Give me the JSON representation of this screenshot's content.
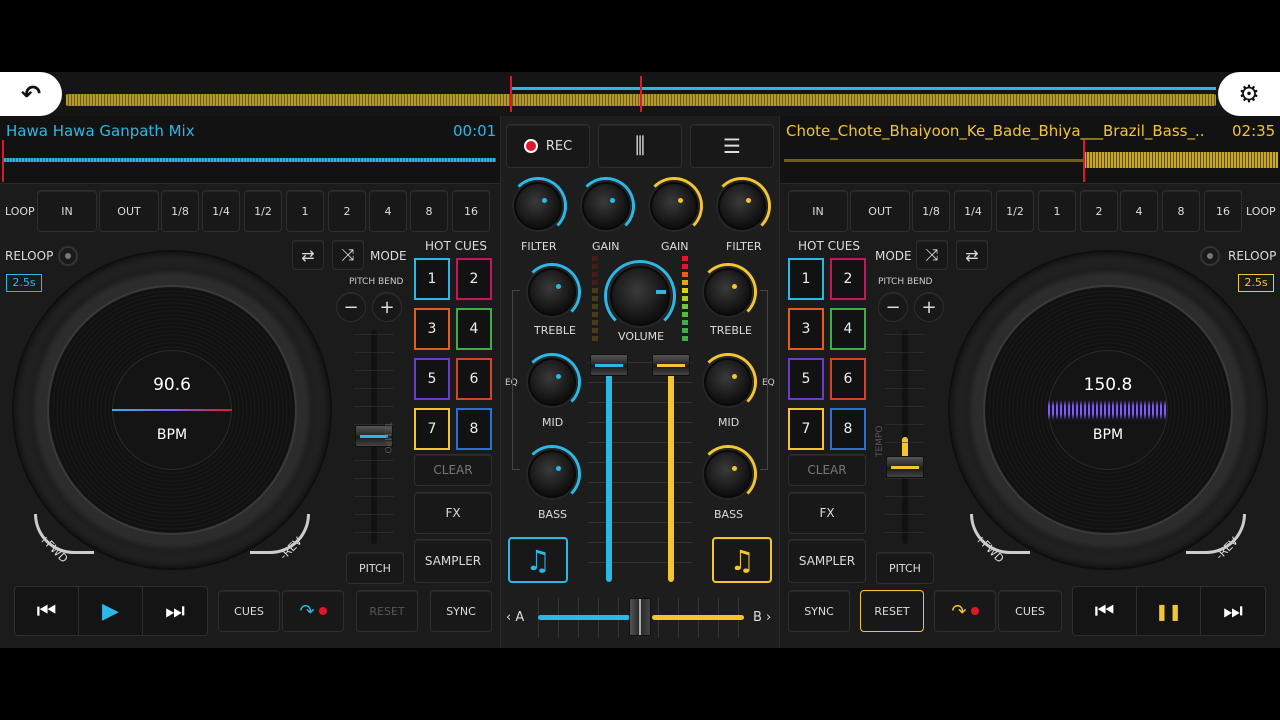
{
  "colors": {
    "deckA": "#2bb8e6",
    "deckB": "#f2c531",
    "rec": "#e0162b",
    "bg": "#1b1b1b"
  },
  "icons": {
    "back": "↶",
    "settings": "⚙",
    "menu": "☰",
    "mixer": "⫼",
    "prev": "⏮",
    "play": "▶",
    "next": "⏭",
    "pause": "❚❚",
    "loop_arrows": "⇄",
    "shuffle": "⤨",
    "music": "♫",
    "minus": "−",
    "plus": "+"
  },
  "deckA": {
    "title": "Hawa Hawa Ganpath Mix",
    "time": "00:01",
    "loop_label": "LOOP",
    "loop_buttons": [
      "IN",
      "OUT",
      "1/8",
      "1/4",
      "1/2",
      "1",
      "2",
      "4",
      "8",
      "16"
    ],
    "reloop": "RELOOP",
    "reloop_time": "2.5s",
    "mode": "MODE",
    "pitch_bend": "PITCH BEND",
    "tempo": "TEMPO",
    "pitch": "PITCH",
    "hot_cues": "HOT CUES",
    "pads": [
      "1",
      "2",
      "3",
      "4",
      "5",
      "6",
      "7",
      "8"
    ],
    "clear": "CLEAR",
    "fx": "FX",
    "sampler": "SAMPLER",
    "bpm": "90.6",
    "bpm_unit": "BPM",
    "fwd": "+FWD",
    "rev": "-REV",
    "cues": "CUES",
    "reset": "RESET",
    "sync": "SYNC"
  },
  "deckB": {
    "title": "Chote_Chote_Bhaiyoon_Ke_Bade_Bhiya___Brazil_Bass_...",
    "time": "02:35",
    "loop_label": "LOOP",
    "loop_buttons": [
      "IN",
      "OUT",
      "1/8",
      "1/4",
      "1/2",
      "1",
      "2",
      "4",
      "8",
      "16"
    ],
    "reloop": "RELOOP",
    "reloop_time": "2.5s",
    "mode": "MODE",
    "pitch_bend": "PITCH BEND",
    "tempo": "TEMPO",
    "pitch": "PITCH",
    "hot_cues": "HOT CUES",
    "pads": [
      "1",
      "2",
      "3",
      "4",
      "5",
      "6",
      "7",
      "8"
    ],
    "clear": "CLEAR",
    "fx": "FX",
    "sampler": "SAMPLER",
    "bpm": "150.8",
    "bpm_unit": "BPM",
    "fwd": "+FWD",
    "rev": "-REV",
    "cues": "CUES",
    "reset": "RESET",
    "sync": "SYNC"
  },
  "mixer": {
    "rec": "REC",
    "filter": "FILTER",
    "gain": "GAIN",
    "treble": "TREBLE",
    "mid": "MID",
    "bass": "BASS",
    "volume": "VOLUME",
    "eq": "EQ",
    "cross_a": "A",
    "cross_b": "B",
    "crossfader_position": 0.5
  }
}
